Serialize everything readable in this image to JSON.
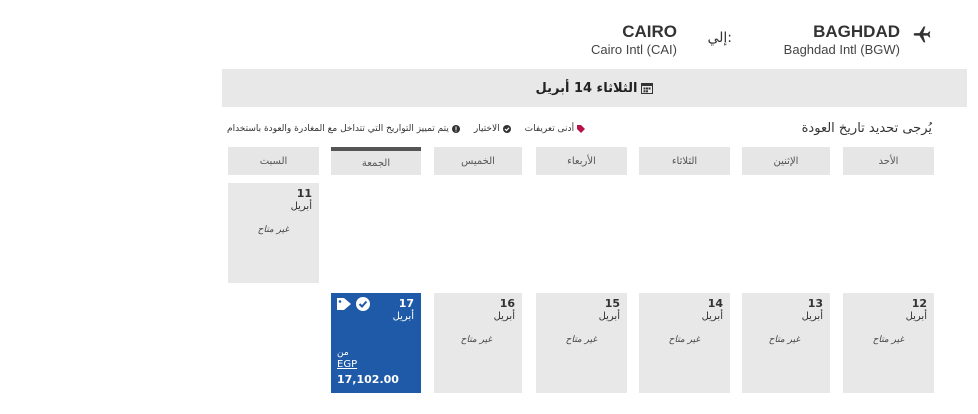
{
  "route": {
    "origin_code": "BAGHDAD",
    "origin_airport": "Baghdad Intl (BGW)",
    "to_label": "إلي:",
    "dest_code": "CAIRO",
    "dest_airport": "Cairo Intl (CAI)"
  },
  "depart_date": "الثلاثاء 14 أبريل",
  "instruction": "يُرجى تحديد تاريخ العودة",
  "legend": {
    "lowest": "أدنى تعريفات",
    "chosen": "الاختيار",
    "note": "يتم تمييز التواريخ التي تتداخل مع المغادرة والعودة باستخدام"
  },
  "days": [
    "الأحد",
    "الإثنين",
    "الثلاثاء",
    "الأربعاء",
    "الخميس",
    "الجمعة",
    "السبت"
  ],
  "cells": [
    {
      "day": "11",
      "month": "أبريل",
      "status": "غير متاح"
    },
    {
      "day": "12",
      "month": "أبريل",
      "status": "غير متاح"
    },
    {
      "day": "13",
      "month": "أبريل",
      "status": "غير متاح"
    },
    {
      "day": "14",
      "month": "أبريل",
      "status": "غير متاح"
    },
    {
      "day": "15",
      "month": "أبريل",
      "status": "غير متاح"
    },
    {
      "day": "16",
      "month": "أبريل",
      "status": "غير متاح"
    },
    {
      "day": "17",
      "month": "أبريل",
      "from": "من",
      "currency": "EGP",
      "price": "17,102.00"
    }
  ],
  "colors": {
    "selected": "#1f5aa8",
    "tag": "#b5134a"
  },
  "icons": {
    "plane": "plane-icon",
    "calendar": "calendar-icon",
    "tag": "tag-icon",
    "check": "check-icon",
    "info": "info-icon"
  }
}
